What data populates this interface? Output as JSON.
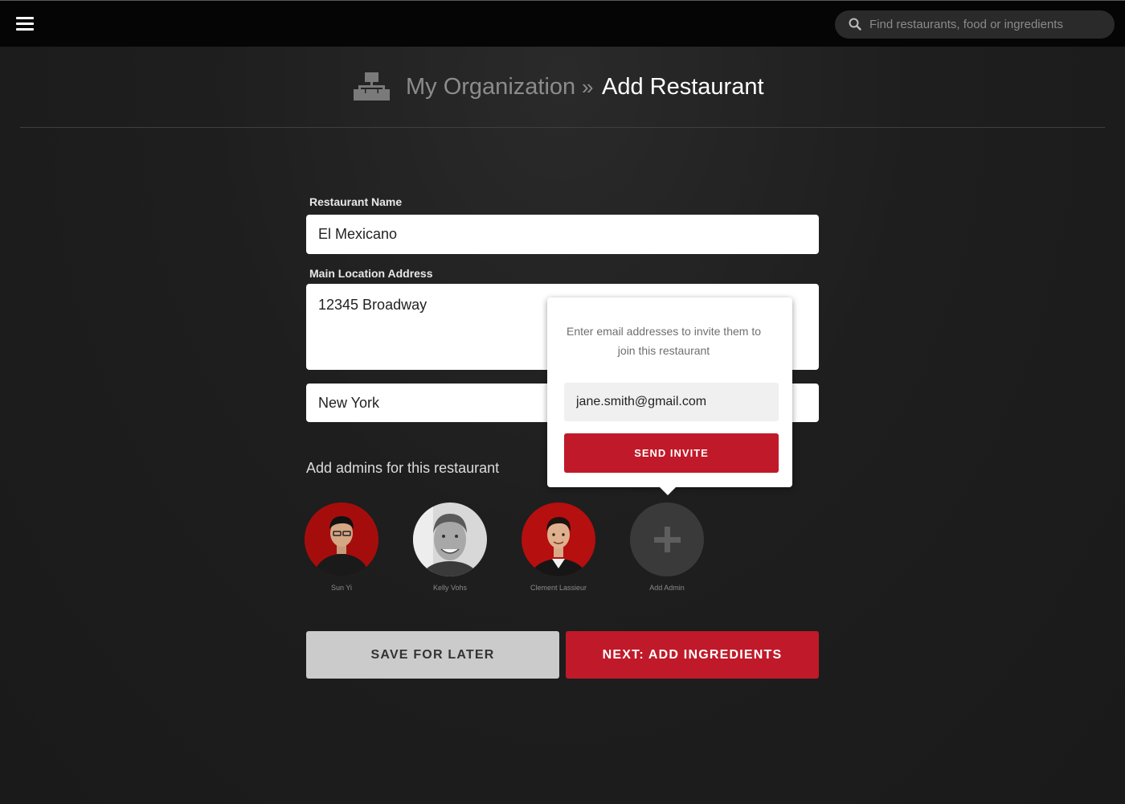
{
  "topbar": {
    "menu_icon": "hamburger-menu-icon",
    "search": {
      "icon": "search-icon",
      "placeholder": "Find restaurants, food or ingredients",
      "value": ""
    }
  },
  "header": {
    "icon": "organization-chart-icon",
    "breadcrumb_parent": "My Organization",
    "breadcrumb_separator": "»",
    "breadcrumb_current": "Add Restaurant"
  },
  "form": {
    "restaurant_name_label": "Restaurant Name",
    "restaurant_name_value": "El Mexicano",
    "address_label": "Main Location Address",
    "address_value": "12345 Broadway",
    "city_value": "New York"
  },
  "admins": {
    "heading": "Add admins for this restaurant",
    "items": [
      {
        "name": "Sun Yi"
      },
      {
        "name": "Kelly Vohs"
      },
      {
        "name": "Clement Lassieur"
      }
    ],
    "add_label": "Add Admin",
    "add_icon": "plus-icon"
  },
  "invite_popover": {
    "message": "Enter email addresses to invite them to join this restaurant",
    "email_value": "jane.smith@gmail.com",
    "send_label": "SEND INVITE"
  },
  "actions": {
    "save_label": "SAVE FOR LATER",
    "next_label": "NEXT: ADD INGREDIENTS"
  },
  "colors": {
    "accent_red": "#c01a2a",
    "background": "#1d1d1d",
    "topbar": "#050505",
    "secondary_button": "#cbcbcb"
  }
}
